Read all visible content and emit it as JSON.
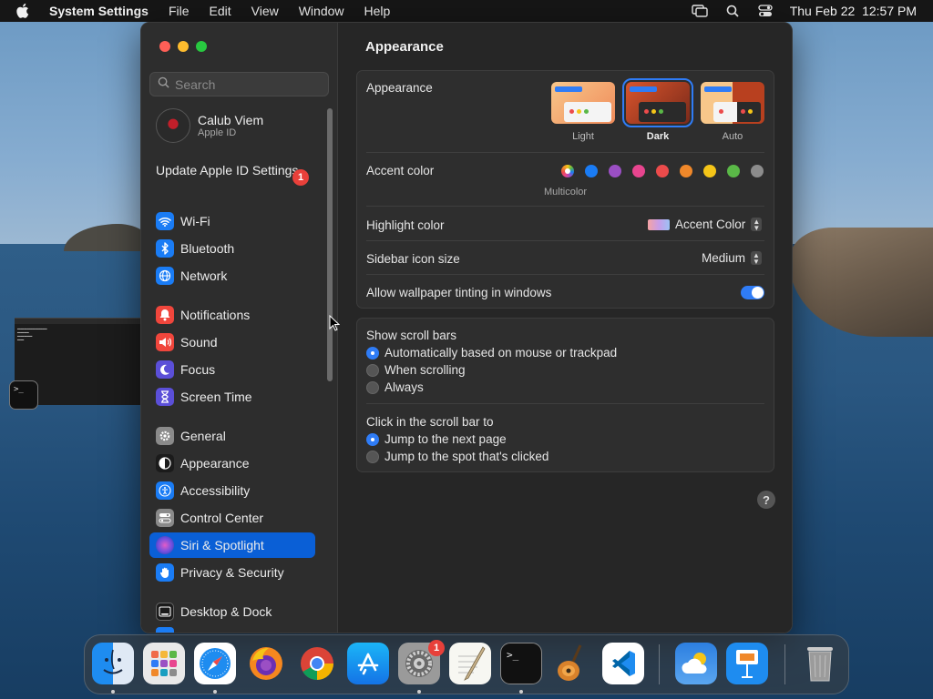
{
  "menubar": {
    "app_name": "System Settings",
    "menus": [
      "File",
      "Edit",
      "View",
      "Window",
      "Help"
    ],
    "clock": "Thu Feb 22  12:57 PM"
  },
  "search": {
    "placeholder": "Search"
  },
  "account": {
    "name": "Calub Viem",
    "subtitle": "Apple ID"
  },
  "update": {
    "label": "Update Apple ID Settings",
    "badge": "1"
  },
  "sidebar": {
    "items": [
      {
        "label": "Wi-Fi",
        "icon": "wifi-icon",
        "color": "#1a7cf5"
      },
      {
        "label": "Bluetooth",
        "icon": "bluetooth-icon",
        "color": "#1a7cf5"
      },
      {
        "label": "Network",
        "icon": "globe-icon",
        "color": "#1a7cf5"
      },
      {
        "label": "Notifications",
        "icon": "bell-icon",
        "color": "#f0463c"
      },
      {
        "label": "Sound",
        "icon": "speaker-icon",
        "color": "#f0463c"
      },
      {
        "label": "Focus",
        "icon": "moon-icon",
        "color": "#5b4fd8"
      },
      {
        "label": "Screen Time",
        "icon": "hourglass-icon",
        "color": "#5b4fd8"
      },
      {
        "label": "General",
        "icon": "gear-icon",
        "color": "#8a8a8a"
      },
      {
        "label": "Appearance",
        "icon": "appearance-icon",
        "color": "#1b1b1b"
      },
      {
        "label": "Accessibility",
        "icon": "accessibility-icon",
        "color": "#1a7cf5"
      },
      {
        "label": "Control Center",
        "icon": "toggles-icon",
        "color": "#8a8a8a"
      },
      {
        "label": "Siri & Spotlight",
        "icon": "siri-icon",
        "color": "#3a2f6b"
      },
      {
        "label": "Privacy & Security",
        "icon": "hand-icon",
        "color": "#1a7cf5"
      },
      {
        "label": "Desktop & Dock",
        "icon": "dock-icon",
        "color": "#1b1b1b"
      }
    ],
    "active": "Siri & Spotlight"
  },
  "content": {
    "title": "Appearance",
    "appearance": {
      "label": "Appearance",
      "options": [
        "Light",
        "Dark",
        "Auto"
      ],
      "selected": "Dark"
    },
    "accent": {
      "label": "Accent color",
      "multicolor_caption": "Multicolor",
      "colors": [
        "#1a7cf5",
        "#9b4fc4",
        "#e8458f",
        "#ec4b4b",
        "#f0882a",
        "#f5c518",
        "#5ab847",
        "#8c8c8c"
      ]
    },
    "highlight": {
      "label": "Highlight color",
      "value": "Accent Color"
    },
    "sidebar_icon_size": {
      "label": "Sidebar icon size",
      "value": "Medium"
    },
    "wallpaper_tinting": {
      "label": "Allow wallpaper tinting in windows",
      "on": true
    },
    "scroll_bars": {
      "label": "Show scroll bars",
      "options": [
        "Automatically based on mouse or trackpad",
        "When scrolling",
        "Always"
      ],
      "selected": 0
    },
    "click_scroll": {
      "label": "Click in the scroll bar to",
      "options": [
        "Jump to the next page",
        "Jump to the spot that's clicked"
      ],
      "selected": 0
    },
    "help": "?"
  },
  "dock": {
    "apps": [
      "finder-icon",
      "launchpad-icon",
      "safari-icon",
      "firefox-icon",
      "chrome-icon",
      "app-store-icon",
      "system-settings-icon",
      "textedit-icon",
      "terminal-icon",
      "garageband-icon",
      "vscode-icon",
      "weather-icon",
      "keynote-icon",
      "trash-icon"
    ],
    "settings_badge": "1"
  },
  "terminal_mini": ">_"
}
